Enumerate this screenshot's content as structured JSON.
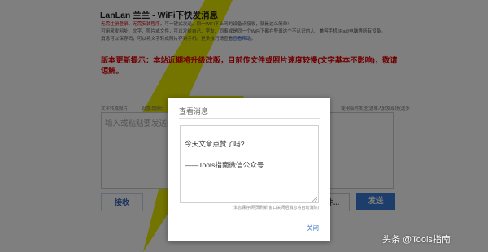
{
  "page": {
    "title": "LanLan 兰兰 - WiFi下快发消息",
    "desc_red": "无需注册登录。无需安装程序。",
    "desc_line1_rest": "可一键式发送。同一WiFi下上网的设备点接收，就是这么简单!",
    "desc_line2": "可用来发网址、文字、照片或文件，可以发给自己、室友、同事或是同一个WiFi下都在登录这个不认识的人，兼容手机/iPad/电脑等所有设备。",
    "desc_line3_prefix": "消息可以保存码，可以将文字转成照片存到手机。更多技巧请查看",
    "desc_link": "查看帮助",
    "desc_line3_suffix": "。",
    "notice": "版本更新提示：本站近期将升级改版，目前传文件或照片速度较慢(文字基本不影响)，敬请谅解。",
    "toolbar_left": "文字转成照片",
    "toolbar_left2": "设置消息码",
    "toolbar_right": "使用临时发送(选单人)",
    "toolbar_right2": "只发现场(选多人)",
    "input_placeholder": "输入或粘贴要发送的",
    "receive_button": "接收",
    "file_button": "件...",
    "send_button": "发送"
  },
  "modal": {
    "title": "查看消息",
    "message": "今天文章点赞了吗?\n\n——Tools指南微信公众号",
    "hint": "消息保存(网页刷新/窗口关闭后消息将自动消除)",
    "close": "关闭"
  },
  "watermark": "头条 @Tools指南",
  "colors": {
    "accent": "#3a7bd5",
    "notice_red": "#e00000",
    "bolt_yellow": "#e6e600"
  }
}
